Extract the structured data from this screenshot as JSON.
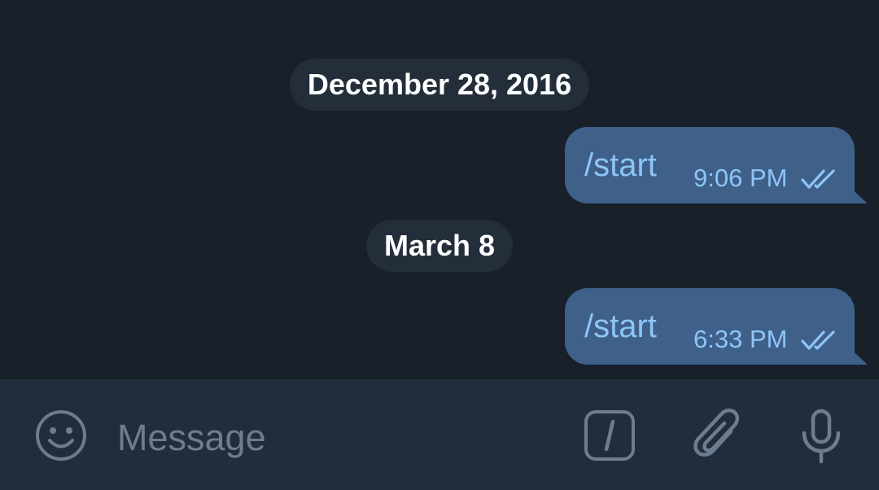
{
  "messages_area": {
    "date_separators": [
      {
        "label": "December 28, 2016"
      },
      {
        "label": "March 8"
      }
    ],
    "messages": [
      {
        "text": "/start",
        "time": "9:06 PM",
        "status": "read-double-check"
      },
      {
        "text": "/start",
        "time": "6:33 PM",
        "status": "read-double-check"
      }
    ]
  },
  "composer": {
    "placeholder": "Message",
    "icons": [
      "emoji-icon",
      "bot-command-icon",
      "attach-icon",
      "microphone-icon"
    ]
  },
  "colors": {
    "background": "#18202a",
    "date_pill": "#232e3a",
    "outgoing_bubble": "#3f6089",
    "outgoing_text": "#8ec5f8",
    "composer_bg": "#212d3b",
    "icon": "#6d7d8f"
  }
}
